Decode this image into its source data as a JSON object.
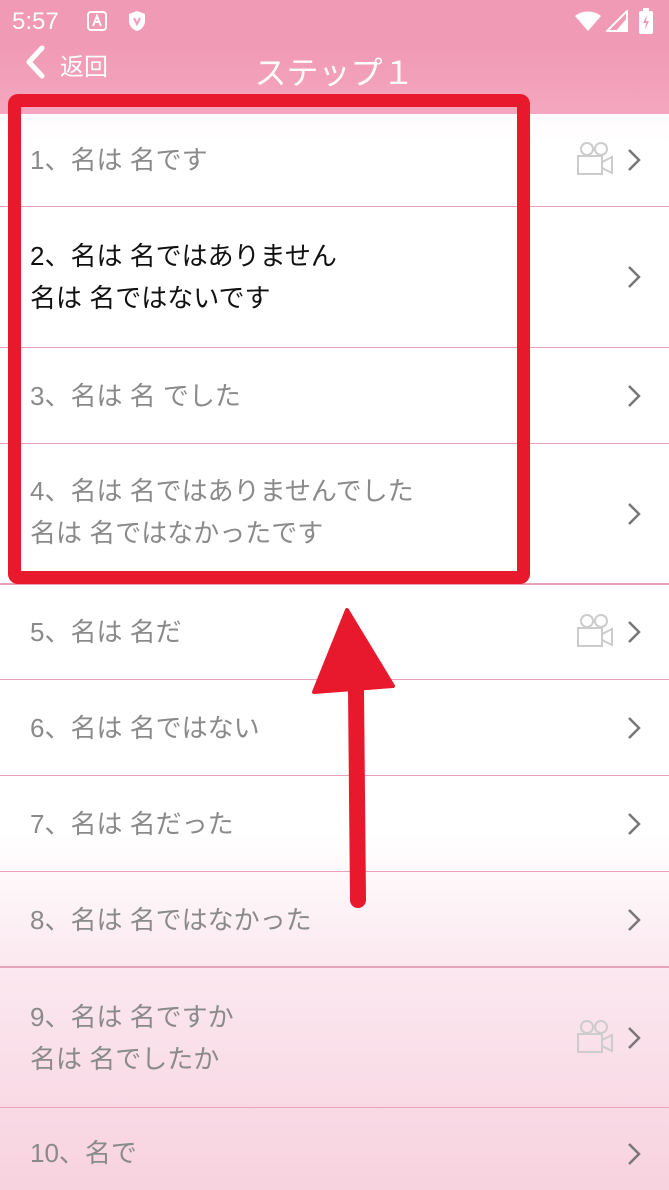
{
  "status_bar": {
    "time": "5:57",
    "icons": [
      "a-notification-icon",
      "shield-icon",
      "wifi-icon",
      "signal-icon",
      "battery-icon"
    ]
  },
  "header": {
    "back_label": "返回",
    "title": "ステップ１"
  },
  "rows": [
    {
      "lines": [
        "1、名は 名です"
      ],
      "has_video": true
    },
    {
      "lines": [
        "2、名は 名ではありません",
        "名は 名ではないです"
      ],
      "has_video": false
    },
    {
      "lines": [
        "3、名は 名 でした"
      ],
      "has_video": false
    },
    {
      "lines": [
        "4、名は 名ではありませんでした",
        "名は 名ではなかったです"
      ],
      "has_video": false
    },
    {
      "lines": [
        "5、名は 名だ"
      ],
      "has_video": true
    },
    {
      "lines": [
        "6、名は 名ではない"
      ],
      "has_video": false
    },
    {
      "lines": [
        "7、名は 名だった"
      ],
      "has_video": false
    },
    {
      "lines": [
        "8、名は 名ではなかった"
      ],
      "has_video": false
    },
    {
      "lines": [
        "9、名は 名ですか",
        "名は 名でしたか"
      ],
      "has_video": true
    },
    {
      "lines": [
        "10、名で"
      ],
      "has_video": false
    }
  ],
  "colors": {
    "header_pink": "#f19ab5",
    "divider_pink": "#e9a3b8",
    "annotation_red": "#e8192c",
    "text_gray": "#8a8a8a"
  }
}
